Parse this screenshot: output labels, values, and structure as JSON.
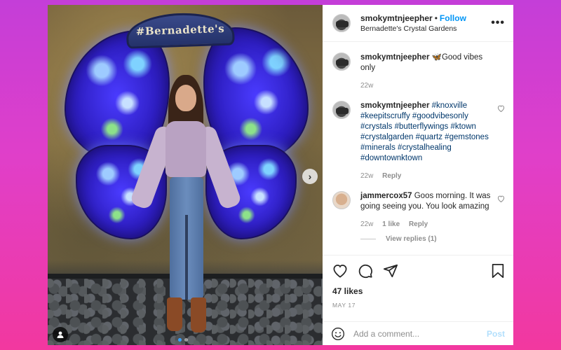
{
  "photo": {
    "sign_text": "#Bernadette's",
    "next_arrow": "›",
    "tag_icon": "user-tag-icon",
    "carousel": {
      "total": 2,
      "current": 1
    }
  },
  "header": {
    "username": "smokymtnjeepher",
    "separator": "•",
    "follow_label": "Follow",
    "location": "Bernadette's Crystal Gardens",
    "more_icon": "•••"
  },
  "caption": {
    "username": "smokymtnjeepher",
    "emoji": "🦋",
    "text": "Good vibes only",
    "time": "22w"
  },
  "comments": [
    {
      "username": "smokymtnjeepher",
      "text": "#knoxville #keepitscruffy #goodvibesonly #crystals #butterflywings #ktown #crystalgarden #quartz #gemstones #minerals #crystalhealing #downtownktown",
      "time": "22w",
      "reply_label": "Reply"
    },
    {
      "username": "jammercox57",
      "text": "Goos morning. It was going seeing you. You look amazing",
      "time": "22w",
      "likes_label": "1 like",
      "reply_label": "Reply",
      "view_replies": "View replies (1)"
    }
  ],
  "actions": {
    "likes": "47 likes",
    "date": "MAY 17"
  },
  "add_comment": {
    "placeholder": "Add a comment...",
    "post_label": "Post"
  },
  "colors": {
    "accent": "#0095f6",
    "hashtag": "#00376b",
    "muted": "#8e8e8e",
    "post_disabled": "#b2dffc"
  }
}
